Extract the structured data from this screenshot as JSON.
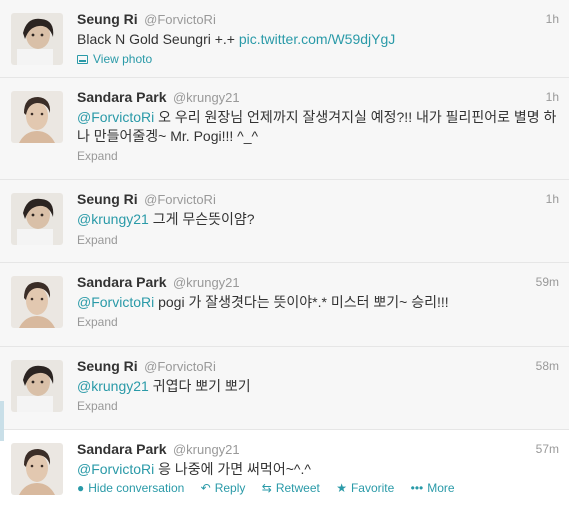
{
  "tweets": [
    {
      "fullname": "Seung Ri",
      "username": "@ForvictoRi",
      "time": "1h",
      "text": "Black N Gold Seungri +.+ ",
      "link": "pic.twitter.com/W59djYgJ",
      "view_photo": "View photo"
    },
    {
      "fullname": "Sandara Park",
      "username": "@krungy21",
      "time": "1h",
      "mention": "@ForvictoRi",
      "text": " 오 우리 원장님 언제까지 잘생겨지실 예정?!! 내가 필리핀어로 별명 하나 만들어줄겡~ Mr. Pogi!!! ^_^",
      "expand": "Expand"
    },
    {
      "fullname": "Seung Ri",
      "username": "@ForvictoRi",
      "time": "1h",
      "mention": "@krungy21",
      "text": " 그게 무슨뜻이얌?",
      "expand": "Expand"
    },
    {
      "fullname": "Sandara Park",
      "username": "@krungy21",
      "time": "59m",
      "mention": "@ForvictoRi",
      "text": " pogi 가 잘생겻다는 뜻이야*.* 미스터 뽀기~ 승리!!!",
      "expand": "Expand"
    },
    {
      "fullname": "Seung Ri",
      "username": "@ForvictoRi",
      "time": "58m",
      "mention": "@krungy21",
      "text": " 귀엽다 뽀기 뽀기",
      "expand": "Expand"
    },
    {
      "fullname": "Sandara Park",
      "username": "@krungy21",
      "time": "57m",
      "mention": "@ForvictoRi",
      "text": " 응 나중에 가면 써먹어~^.^",
      "actions": {
        "hide_conversation": "Hide conversation",
        "reply": "Reply",
        "retweet": "Retweet",
        "favorite": "Favorite",
        "more": "More"
      }
    }
  ],
  "colors": {
    "link": "#2a9aa8",
    "muted": "#999999",
    "collapsed_bg": "#f7f7f7",
    "expanded_bg": "#ffffff"
  },
  "icons": [
    "photo-icon",
    "speech-bubble-icon",
    "reply-arrow-icon",
    "retweet-icon",
    "star-icon",
    "ellipsis-icon"
  ]
}
